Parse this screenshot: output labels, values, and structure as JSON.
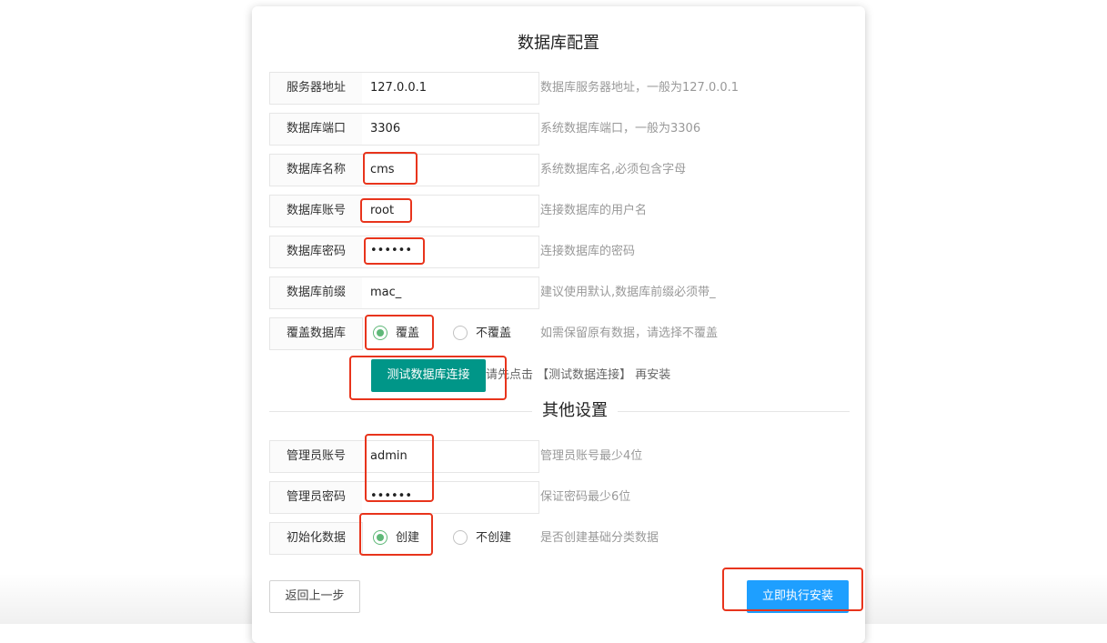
{
  "db_section_title": "数据库配置",
  "fields": {
    "server": {
      "label": "服务器地址",
      "value": "127.0.0.1",
      "hint": "数据库服务器地址，一般为127.0.0.1"
    },
    "port": {
      "label": "数据库端口",
      "value": "3306",
      "hint": "系统数据库端口，一般为3306"
    },
    "dbname": {
      "label": "数据库名称",
      "value": "cms",
      "hint": "系统数据库名,必须包含字母"
    },
    "account": {
      "label": "数据库账号",
      "value": "root",
      "hint": "连接数据库的用户名"
    },
    "password": {
      "label": "数据库密码",
      "value": "••••••",
      "hint": "连接数据库的密码"
    },
    "prefix": {
      "label": "数据库前缀",
      "value": "mac_",
      "hint": "建议使用默认,数据库前缀必须带_"
    }
  },
  "cover_db": {
    "label": "覆盖数据库",
    "options": [
      "覆盖",
      "不覆盖"
    ],
    "selected": "覆盖",
    "hint": "如需保留原有数据，请选择不覆盖"
  },
  "test_button": {
    "label": "测试数据库连接",
    "hint": "请先点击 【测试数据连接】 再安装"
  },
  "other_section_title": "其他设置",
  "admin": {
    "account": {
      "label": "管理员账号",
      "value": "admin",
      "hint": "管理员账号最少4位"
    },
    "password": {
      "label": "管理员密码",
      "value": "••••••",
      "hint": "保证密码最少6位"
    }
  },
  "init_data": {
    "label": "初始化数据",
    "options": [
      "创建",
      "不创建"
    ],
    "selected": "创建",
    "hint": "是否创建基础分类数据"
  },
  "buttons": {
    "back": "返回上一步",
    "install": "立即执行安装"
  },
  "colors": {
    "test_button": "#009688",
    "install_button": "#1e9fff",
    "radio_checked": "#5fb878",
    "annotation_box": "#e8341c"
  }
}
